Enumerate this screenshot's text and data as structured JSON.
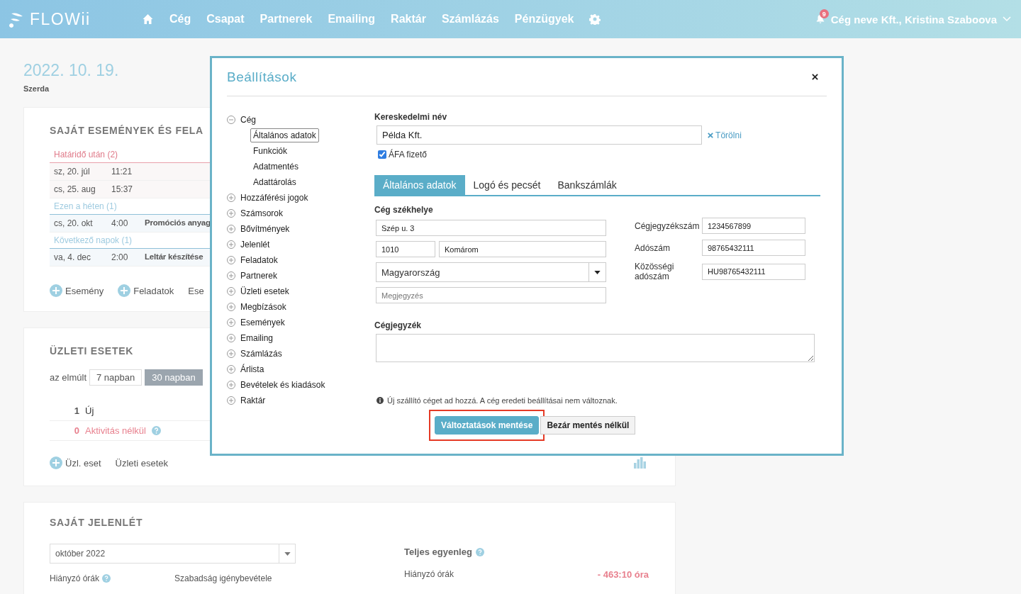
{
  "nav": {
    "logo": "FLOWii",
    "items": [
      "Cég",
      "Csapat",
      "Partnerek",
      "Emailing",
      "Raktár",
      "Számlázás",
      "Pénzügyek"
    ],
    "notifications": "9",
    "account": "Cég neve Kft., Kristina Szaboova"
  },
  "date": {
    "value": "2022. 10. 19.",
    "weekday": "Szerda"
  },
  "events_card": {
    "title": "SAJÁT ESEMÉNYEK ÉS FELA",
    "groups": [
      {
        "label": "Határidő után (2)",
        "kind": "overdue",
        "rows": [
          {
            "date": "sz, 20. júl",
            "time": "11:21"
          },
          {
            "date": "cs, 25. aug",
            "time": "15:37"
          }
        ]
      },
      {
        "label": "Ezen a héten (1)",
        "kind": "upcoming",
        "rows": [
          {
            "date": "cs, 20. okt",
            "time": "4:00",
            "title": "Promóciós anyag"
          }
        ]
      },
      {
        "label": "Következő napok (1)",
        "kind": "upcoming",
        "rows": [
          {
            "date": "va, 4. dec",
            "time": "2:00",
            "title": "Leltár készítése"
          }
        ]
      }
    ],
    "actions": [
      {
        "label": "Esemény",
        "kind": "add"
      },
      {
        "label": "Feladatok",
        "kind": "add"
      },
      {
        "label": "Ese",
        "kind": "link"
      }
    ]
  },
  "deals_card": {
    "title": "ÜZLETI ESETEK",
    "period_label": "az elmúlt",
    "periods": [
      {
        "label": "7 napban",
        "selected": false
      },
      {
        "label": "30 napban",
        "selected": true
      }
    ],
    "stats": [
      {
        "count": "1",
        "label": "Új",
        "kind": "normal",
        "help": false
      },
      {
        "count": "0",
        "label": "Aktivitás nélkül",
        "kind": "alert",
        "help": true
      }
    ],
    "actions": [
      {
        "label": "Üzl. eset",
        "kind": "add"
      },
      {
        "label": "Üzleti esetek",
        "kind": "link"
      }
    ]
  },
  "attendance_card": {
    "title": "SAJÁT JELENLÉT",
    "month": "október 2022",
    "balance_title": "Teljes egyenleg",
    "columns": [
      {
        "label": "Hiányzó órák",
        "help": true
      },
      {
        "label": "Szabadság igénybevétele",
        "help": false
      }
    ],
    "balance_label": "Hiányzó órák",
    "balance_value": "- 463:10 óra"
  },
  "dialog": {
    "title": "Beállítások",
    "tree": [
      {
        "label": "Cég",
        "expanded": true,
        "children": [
          {
            "label": "Általános adatok",
            "selected": true
          },
          {
            "label": "Funkciók",
            "selected": false
          },
          {
            "label": "Adatmentés",
            "selected": false
          },
          {
            "label": "Adattárolás",
            "selected": false
          }
        ]
      },
      {
        "label": "Hozzáférési jogok",
        "expanded": false
      },
      {
        "label": "Számsorok",
        "expanded": false
      },
      {
        "label": "Bővítmények",
        "expanded": false
      },
      {
        "label": "Jelenlét",
        "expanded": false
      },
      {
        "label": "Feladatok",
        "expanded": false
      },
      {
        "label": "Partnerek",
        "expanded": false
      },
      {
        "label": "Üzleti esetek",
        "expanded": false
      },
      {
        "label": "Megbízások",
        "expanded": false
      },
      {
        "label": "Események",
        "expanded": false
      },
      {
        "label": "Emailing",
        "expanded": false
      },
      {
        "label": "Számlázás",
        "expanded": false
      },
      {
        "label": "Árlista",
        "expanded": false
      },
      {
        "label": "Bevételek és kiadások",
        "expanded": false
      },
      {
        "label": "Raktár",
        "expanded": false
      }
    ],
    "trade_name": {
      "label": "Kereskedelmi név",
      "value": "Példa Kft.",
      "clear": "Törölni"
    },
    "vat": {
      "label": "ÁFA fizető",
      "checked": true
    },
    "tabs": [
      {
        "label": "Általános adatok",
        "selected": true
      },
      {
        "label": "Logó és pecsét",
        "selected": false
      },
      {
        "label": "Bankszámlák",
        "selected": false
      }
    ],
    "address": {
      "label": "Cég székhelye",
      "street": "Szép u. 3",
      "zip": "1010",
      "city": "Komárom",
      "country": "Magyarország",
      "note_placeholder": "Megjegyzés"
    },
    "ids": [
      {
        "label": "Cégjegyzékszám",
        "value": "1234567899"
      },
      {
        "label": "Adószám",
        "value": "98765432111"
      },
      {
        "label": "Közösségi adószám",
        "value": "HU98765432111"
      }
    ],
    "registry": {
      "label": "Cégjegyzék"
    },
    "info": "Új szállító céget ad hozzá. A cég eredeti beállításai nem változnak.",
    "buttons": [
      {
        "label": "Változtatások mentése",
        "kind": "primary",
        "highlighted": true
      },
      {
        "label": "Bezár mentés nélkül",
        "kind": "secondary",
        "highlighted": false
      }
    ]
  }
}
